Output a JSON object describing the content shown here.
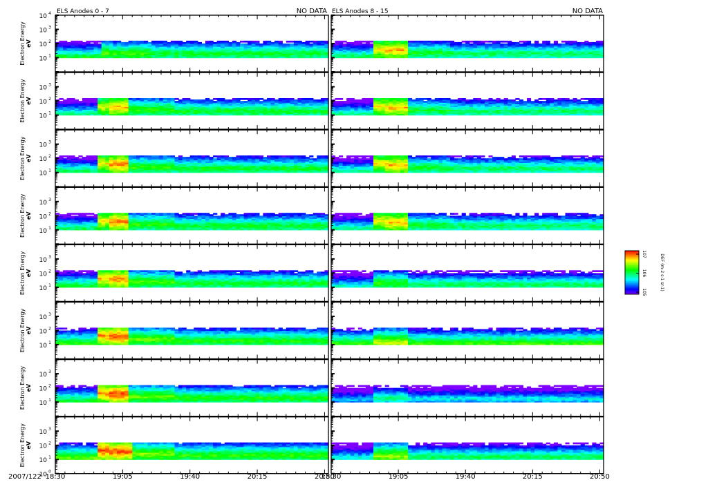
{
  "chart_data": {
    "type": "heatmap",
    "title_left": "ELS Anodes 0 - 7",
    "title_right": "ELS Anodes 8 - 15",
    "no_data_left": "NO DATA",
    "no_data_right": "NO DATA",
    "ylabel": "Electron Energy",
    "yunit": "eV",
    "ylim_log10": [
      0,
      4
    ],
    "y_ticks": [
      {
        "base": "10",
        "exp": "0"
      },
      {
        "base": "10",
        "exp": "1"
      },
      {
        "base": "10",
        "exp": "2"
      },
      {
        "base": "10",
        "exp": "3"
      },
      {
        "base": "10",
        "exp": "4"
      }
    ],
    "date_label": "2007/122",
    "x_range_minutes_from_1830": [
      0,
      142
    ],
    "x_tick_labels": [
      "18:30",
      "19:05",
      "19:40",
      "20:15",
      "20:50"
    ],
    "x_tick_minutes": [
      0,
      35,
      70,
      105,
      140
    ],
    "colorbar": {
      "label": "DEF (m-2 s-1 sr-1)",
      "ticks": [
        {
          "base": "10",
          "exp": "7"
        },
        {
          "base": "10",
          "exp": "6"
        },
        {
          "base": "10",
          "exp": "5"
        }
      ],
      "scale": "log"
    },
    "energy_band_log10": [
      1.0,
      2.2
    ],
    "panels": [
      {
        "column": "left",
        "anode": 0,
        "segments": [
          [
            0,
            23,
            0.55,
            1.05
          ],
          [
            23,
            28,
            0.65,
            1.35
          ],
          [
            28,
            50,
            0.62,
            1.3
          ],
          [
            50,
            140,
            0.55,
            1.3
          ]
        ]
      },
      {
        "column": "left",
        "anode": 1,
        "segments": [
          [
            0,
            22,
            0.45,
            1.1
          ],
          [
            22,
            28,
            0.75,
            1.6
          ],
          [
            28,
            38,
            0.85,
            1.6
          ],
          [
            38,
            62,
            0.6,
            1.4
          ],
          [
            62,
            140,
            0.55,
            1.3
          ]
        ]
      },
      {
        "column": "left",
        "anode": 2,
        "segments": [
          [
            0,
            22,
            0.5,
            1.1
          ],
          [
            22,
            28,
            0.8,
            1.65
          ],
          [
            28,
            38,
            0.9,
            1.6
          ],
          [
            38,
            62,
            0.6,
            1.4
          ],
          [
            62,
            140,
            0.55,
            1.3
          ]
        ]
      },
      {
        "column": "left",
        "anode": 3,
        "segments": [
          [
            0,
            22,
            0.5,
            1.1
          ],
          [
            22,
            28,
            0.8,
            1.65
          ],
          [
            28,
            38,
            0.9,
            1.6
          ],
          [
            38,
            62,
            0.6,
            1.4
          ],
          [
            62,
            140,
            0.55,
            1.3
          ]
        ]
      },
      {
        "column": "left",
        "anode": 4,
        "segments": [
          [
            0,
            22,
            0.55,
            1.1
          ],
          [
            22,
            28,
            0.85,
            1.65
          ],
          [
            28,
            38,
            0.9,
            1.6
          ],
          [
            38,
            62,
            0.62,
            1.4
          ],
          [
            62,
            140,
            0.55,
            1.3
          ]
        ]
      },
      {
        "column": "left",
        "anode": 5,
        "segments": [
          [
            0,
            22,
            0.6,
            1.1
          ],
          [
            22,
            28,
            0.9,
            1.65
          ],
          [
            28,
            38,
            0.95,
            1.6
          ],
          [
            38,
            62,
            0.65,
            1.4
          ],
          [
            62,
            140,
            0.58,
            1.3
          ]
        ]
      },
      {
        "column": "left",
        "anode": 6,
        "segments": [
          [
            0,
            22,
            0.55,
            1.1
          ],
          [
            22,
            28,
            0.9,
            1.65
          ],
          [
            28,
            38,
            0.95,
            1.6
          ],
          [
            38,
            62,
            0.65,
            1.4
          ],
          [
            62,
            140,
            0.58,
            1.3
          ]
        ]
      },
      {
        "column": "left",
        "anode": 7,
        "segments": [
          [
            0,
            22,
            0.65,
            1.1
          ],
          [
            22,
            28,
            0.95,
            1.65
          ],
          [
            28,
            40,
            0.95,
            1.6
          ],
          [
            40,
            62,
            0.68,
            1.4
          ],
          [
            62,
            140,
            0.6,
            1.3
          ]
        ]
      },
      {
        "column": "right",
        "anode": 8,
        "segments": [
          [
            0,
            22,
            0.5,
            1.1
          ],
          [
            22,
            28,
            0.8,
            1.6
          ],
          [
            28,
            40,
            0.85,
            1.55
          ],
          [
            40,
            62,
            0.55,
            1.35
          ],
          [
            62,
            140,
            0.5,
            1.3
          ]
        ]
      },
      {
        "column": "right",
        "anode": 9,
        "segments": [
          [
            0,
            22,
            0.45,
            1.1
          ],
          [
            22,
            28,
            0.8,
            1.65
          ],
          [
            28,
            40,
            0.85,
            1.55
          ],
          [
            40,
            62,
            0.55,
            1.35
          ],
          [
            62,
            140,
            0.5,
            1.3
          ]
        ]
      },
      {
        "column": "right",
        "anode": 10,
        "segments": [
          [
            0,
            22,
            0.45,
            1.1
          ],
          [
            22,
            28,
            0.8,
            1.65
          ],
          [
            28,
            40,
            0.85,
            1.55
          ],
          [
            40,
            62,
            0.55,
            1.35
          ],
          [
            62,
            140,
            0.5,
            1.3
          ]
        ]
      },
      {
        "column": "right",
        "anode": 11,
        "segments": [
          [
            0,
            22,
            0.45,
            1.1
          ],
          [
            22,
            28,
            0.8,
            1.65
          ],
          [
            28,
            40,
            0.85,
            1.55
          ],
          [
            40,
            62,
            0.55,
            1.35
          ],
          [
            62,
            140,
            0.5,
            1.3
          ]
        ]
      },
      {
        "column": "right",
        "anode": 12,
        "segments": [
          [
            0,
            22,
            0.4,
            1.1
          ],
          [
            22,
            40,
            0.6,
            1.3
          ],
          [
            40,
            140,
            0.5,
            1.2
          ]
        ]
      },
      {
        "column": "right",
        "anode": 13,
        "segments": [
          [
            0,
            22,
            0.6,
            1.1
          ],
          [
            22,
            40,
            0.75,
            1.15
          ],
          [
            40,
            140,
            0.62,
            1.1
          ]
        ]
      },
      {
        "column": "right",
        "anode": 14,
        "segments": [
          [
            0,
            22,
            0.3,
            1.2
          ],
          [
            22,
            40,
            0.45,
            1.3
          ],
          [
            40,
            140,
            0.35,
            1.25
          ]
        ]
      },
      {
        "column": "right",
        "anode": 15,
        "segments": [
          [
            0,
            22,
            0.4,
            1.1
          ],
          [
            22,
            40,
            0.7,
            1.25
          ],
          [
            40,
            140,
            0.5,
            1.2
          ]
        ]
      }
    ]
  }
}
